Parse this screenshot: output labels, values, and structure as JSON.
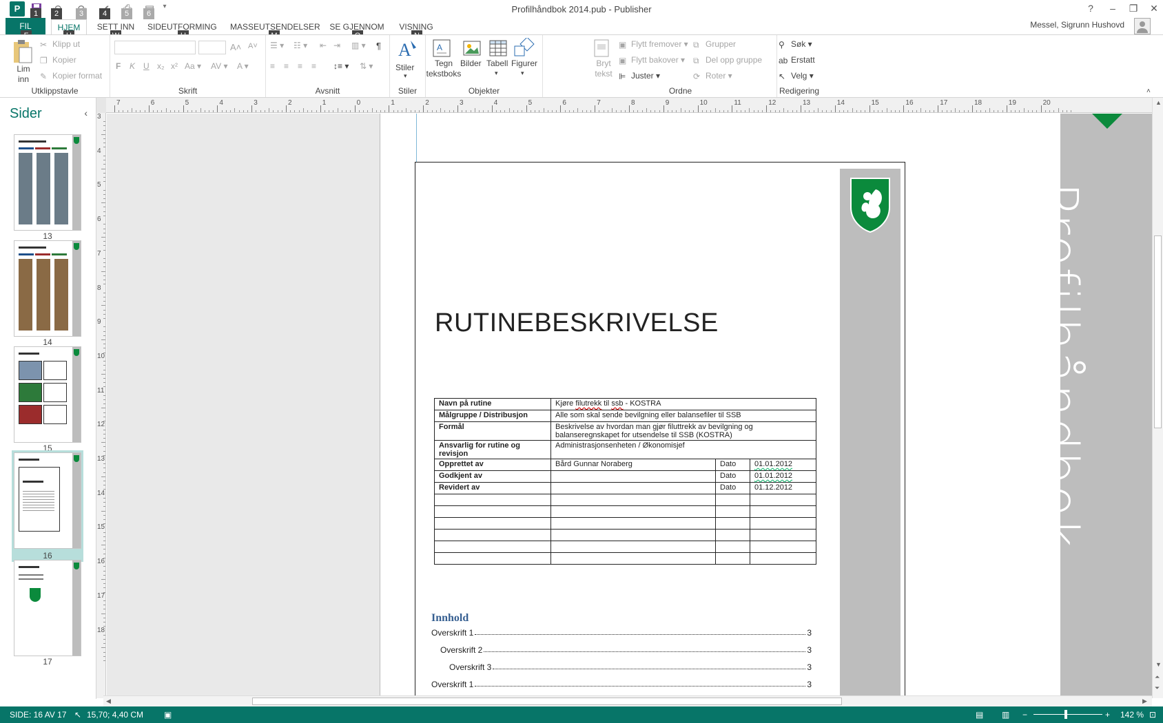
{
  "window": {
    "title": "Profilhåndbok 2014.pub - Publisher",
    "help": "?",
    "minimize": "–",
    "restore": "❐",
    "close": "✕",
    "user": "Messel, Sigrunn Hushovd"
  },
  "qat": {
    "app_letter": "P",
    "keytips": [
      "1",
      "2",
      "3",
      "4",
      "5",
      "6"
    ]
  },
  "tabs": [
    {
      "label": "FIL",
      "keytip": "F"
    },
    {
      "label": "HJEM",
      "keytip": "H"
    },
    {
      "label": "SETT INN",
      "keytip": "W"
    },
    {
      "label": "SIDEUTFORMING",
      "keytip": "U"
    },
    {
      "label": "MASSEUTSENDELSER",
      "keytip": "M"
    },
    {
      "label": "SE GJENNOM",
      "keytip": "O"
    },
    {
      "label": "VISNING",
      "keytip": "N"
    }
  ],
  "ribbon": {
    "clipboard": {
      "label": "Utklippstavle",
      "paste": "Lim inn",
      "cut": "Klipp ut",
      "copy": "Kopier",
      "format_painter": "Kopier format"
    },
    "font": {
      "label": "Skrift"
    },
    "paragraph": {
      "label": "Avsnitt"
    },
    "styles": {
      "label": "Stiler",
      "button": "Stiler"
    },
    "objects": {
      "label": "Objekter",
      "textbox": "Tegn tekstboks",
      "pictures": "Bilder",
      "table": "Tabell",
      "shapes": "Figurer"
    },
    "arrange": {
      "label": "Ordne",
      "wrap_text": "Bryt tekst",
      "bring_forward": "Flytt fremover",
      "send_backward": "Flytt bakover",
      "align": "Juster",
      "group": "Grupper",
      "ungroup": "Del opp gruppe",
      "rotate": "Roter"
    },
    "editing": {
      "label": "Redigering",
      "find": "Søk",
      "replace": "Erstatt",
      "select": "Velg"
    }
  },
  "pages_pane": {
    "title": "Sider",
    "thumbnails": [
      {
        "number": "13",
        "selected": false
      },
      {
        "number": "14",
        "selected": false
      },
      {
        "number": "15",
        "selected": false
      },
      {
        "number": "16",
        "selected": true
      },
      {
        "number": "17",
        "selected": false
      }
    ]
  },
  "rulers": {
    "horizontal": [
      "7",
      "6",
      "5",
      "4",
      "3",
      "2",
      "1",
      "0",
      "1",
      "2",
      "3",
      "4",
      "5",
      "6",
      "7",
      "8",
      "9",
      "10",
      "11",
      "12",
      "13",
      "14",
      "15",
      "16",
      "17",
      "18",
      "19",
      "20"
    ],
    "vertical": [
      "3",
      "4",
      "5",
      "6",
      "7",
      "8",
      "9",
      "10",
      "11",
      "12",
      "13",
      "14",
      "15",
      "16",
      "17",
      "18"
    ]
  },
  "document": {
    "vertical_title": "Profilhåndbok",
    "heading": "RUTINEBESKRIVELSE",
    "table": {
      "routine_name_label": "Navn på rutine",
      "routine_name_parts": [
        "Kjøre ",
        "filutrekk",
        " til ",
        "ssb",
        " - KOSTRA"
      ],
      "audience_label": "Målgruppe / Distribusjon",
      "audience": "Alle som skal sende bevilgning eller balansefiler til SSB",
      "purpose_label": "Formål",
      "purpose": "Beskrivelse av hvordan man gjør filuttrekk av bevilgning og balanseregnskapet for utsendelse til SSB (KOSTRA)",
      "responsible_label": "Ansvarlig for rutine og revisjon",
      "responsible": "Administrasjonsenheten / Økonomisjef",
      "created_label": "Opprettet av",
      "created_by": "Bård Gunnar Noraberg",
      "approved_label": "Godkjent av",
      "revised_label": "Revidert av",
      "date_label": "Dato",
      "created_date": "01.01.2012",
      "approved_date": "01.01.2012",
      "revised_date": "01.12.2012"
    },
    "toc": {
      "title": "Innhold",
      "entries": [
        {
          "text": "Overskrift 1",
          "page": "3"
        },
        {
          "text": "Overskrift 2",
          "page": "3"
        },
        {
          "text": "Overskrift 3",
          "page": "3"
        },
        {
          "text": "Overskrift 1",
          "page": "3"
        }
      ]
    }
  },
  "status": {
    "page": "SIDE: 16 AV 17",
    "position": "15,70; 4,40 CM",
    "zoom": "142 %",
    "zoom_out": "−",
    "zoom_in": "+"
  },
  "colors": {
    "accent": "#077568",
    "shield_green": "#0b8a3c",
    "strip_gray": "#bdbdbd",
    "toc_blue": "#365f91"
  }
}
